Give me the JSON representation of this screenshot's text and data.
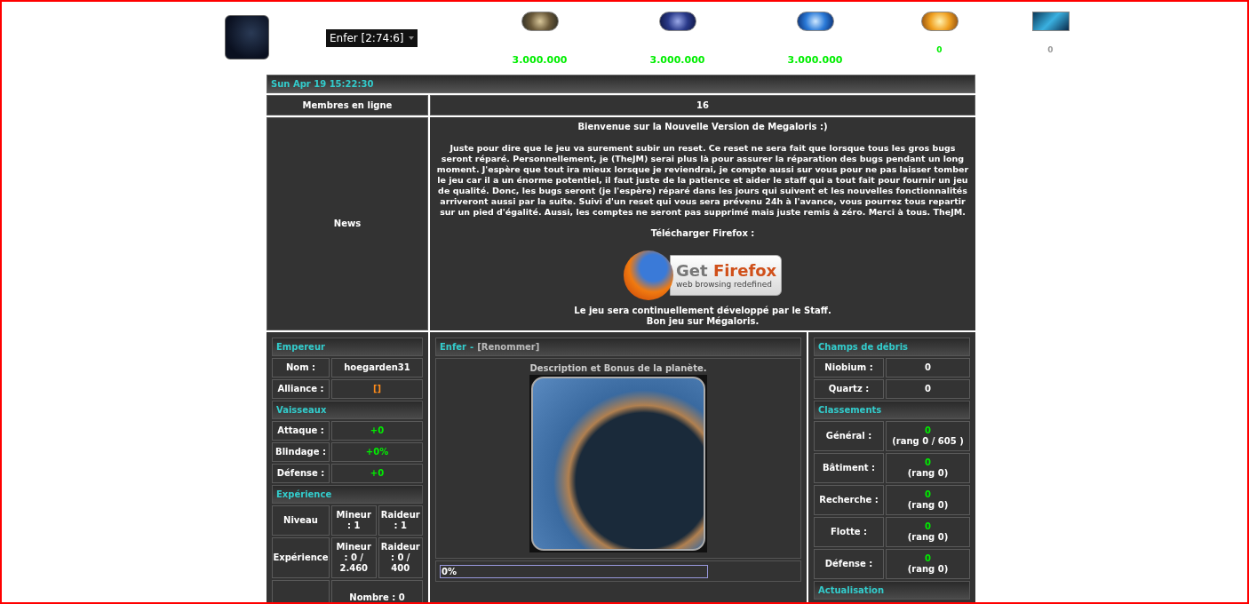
{
  "header": {
    "planet_select": "Enfer [2:74:6]",
    "resources": [
      {
        "kind": "niobium",
        "amount": "3.000.000",
        "color": "#00ee00"
      },
      {
        "kind": "quartz",
        "amount": "3.000.000",
        "color": "#00ee00"
      },
      {
        "kind": "water",
        "amount": "3.000.000",
        "color": "#00ee00"
      },
      {
        "kind": "energy",
        "amount": "0",
        "color": "#00ee00"
      },
      {
        "kind": "dark",
        "amount": "0",
        "color": "#999999"
      }
    ]
  },
  "date": "Sun Apr 19 15:22:30",
  "online": {
    "label": "Membres en ligne",
    "value": "16"
  },
  "news": {
    "label": "News",
    "title": "Bienvenue sur la Nouvelle Version de Megaloris :)",
    "body": "Juste pour dire que le jeu va surement subir un reset. Ce reset ne sera fait que lorsque tous les gros bugs seront réparé. Personnellement, je (TheJM) serai plus là pour assurer la réparation des bugs pendant un long moment. J'espère que tout ira mieux lorsque je reviendrai, je compte aussi sur vous pour ne pas laisser tomber le jeu car il a un énorme potentiel, il faut juste de la patience et aider le staff qui a tout fait pour fournir un jeu de qualité. Donc, les bugs seront (je l'espère) réparé dans les jours qui suivent et les nouvelles fonctionnalités arriveront aussi par la suite. Suivi d'un reset qui vous sera prévenu 24h à l'avance, vous pourrez tous repartir sur un pied d'égalité. Aussi, les comptes ne seront pas supprimé mais juste remis à zéro. Merci à tous. TheJM.",
    "download": "Télécharger Firefox :",
    "badge": {
      "get": "Get",
      "brand": "Firefox",
      "tagline": "web browsing redefined"
    },
    "footer": [
      "Le jeu sera continuellement développé par le Staff.",
      "Bon jeu sur Mégaloris."
    ]
  },
  "left": [
    {
      "title": "Empereur",
      "rows": [
        {
          "label": "Nom :",
          "values": [
            "hoegarden31"
          ],
          "color": "#ffffff"
        },
        {
          "label": "Alliance :",
          "values": [
            "[]"
          ],
          "color": "#ff8c1a"
        }
      ]
    },
    {
      "title": "Vaisseaux",
      "rows": [
        {
          "label": "Attaque :",
          "values": [
            "+0"
          ],
          "color": "#00ee00"
        },
        {
          "label": "Blindage :",
          "values": [
            "+0%"
          ],
          "color": "#00ee00"
        },
        {
          "label": "Défense :",
          "values": [
            "+0"
          ],
          "color": "#00ee00"
        }
      ]
    },
    {
      "title": "Expérience",
      "rows": [
        {
          "label": "Niveau",
          "values": [
            "Mineur : 1",
            "Raideur : 1"
          ],
          "color": "#ffffff"
        },
        {
          "label": "Expérience",
          "values": [
            "Mineur : 0 / 2.460",
            "Raideur : 0 / 400"
          ],
          "color": "#ffffff"
        },
        {
          "label": "",
          "values": [
            "Nombre : 0"
          ],
          "color": "#ffffff"
        }
      ]
    }
  ],
  "planet": {
    "name": "Enfer",
    "separator": "-",
    "rename": "[Renommer]",
    "description": "Description et Bonus de la planète.",
    "progress": {
      "level": 0,
      "reading": "0%"
    }
  },
  "right": [
    {
      "title": "Champs de débris",
      "rows": [
        {
          "label": "Niobium :",
          "value": "0"
        },
        {
          "label": "Quartz :",
          "value": "0"
        }
      ]
    },
    {
      "title": "Classements",
      "rows": [
        {
          "label": "Général :",
          "value": "0",
          "rank": "(rang 0 / 605 )"
        },
        {
          "label": "Bâtiment :",
          "value": "0",
          "rank": "(rang 0)"
        },
        {
          "label": "Recherche :",
          "value": "0",
          "rank": "(rang 0)"
        },
        {
          "label": "Flotte :",
          "value": "0",
          "rank": "(rang 0)"
        },
        {
          "label": "Défense :",
          "value": "0",
          "rank": "(rang 0)"
        }
      ]
    },
    {
      "title": "Actualisation"
    }
  ]
}
